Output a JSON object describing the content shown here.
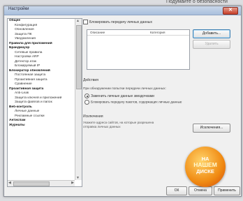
{
  "corner_caption": "Подумайте о безопасности",
  "window": {
    "title": "Настройки",
    "close_glyph": "✕"
  },
  "tree": {
    "items": [
      {
        "label": "Общее",
        "level": 0
      },
      {
        "label": "Конфигурация",
        "level": 1
      },
      {
        "label": "Обновления",
        "level": 1
      },
      {
        "label": "Защита ПК",
        "level": 1
      },
      {
        "label": "Уведомления",
        "level": 1
      },
      {
        "label": "Правила для приложений",
        "level": 0
      },
      {
        "label": "Брандмауэр",
        "level": 0
      },
      {
        "label": "Сетевые правила",
        "level": 1
      },
      {
        "label": "Настройки ARP",
        "level": 1
      },
      {
        "label": "Детектор атак",
        "level": 1
      },
      {
        "label": "Блокируемый IP",
        "level": 1
      },
      {
        "label": "Блокиратор обновлений",
        "level": 0
      },
      {
        "label": "Постоянная защита",
        "level": 1
      },
      {
        "label": "Проактивная защита",
        "level": 1
      },
      {
        "label": "Сравнение",
        "level": 1
      },
      {
        "label": "Проактивная защита",
        "level": 0
      },
      {
        "label": "Anti-Leak",
        "level": 1
      },
      {
        "label": "Защита ключей и приложений",
        "level": 1
      },
      {
        "label": "Защита файлов и папок",
        "level": 1
      },
      {
        "label": "Веб-контроль",
        "level": 0
      },
      {
        "label": "Личные данные",
        "level": 1
      },
      {
        "label": "Рекламные ссылки",
        "level": 1
      },
      {
        "label": "Антиспам",
        "level": 0
      },
      {
        "label": "Журналы",
        "level": 0
      }
    ]
  },
  "private_data": {
    "enable_checkbox_label": "Блокировать передачу личных данных",
    "enable_checked": false,
    "columns": [
      "Описание",
      "Категория"
    ],
    "add_button": "Добавить...",
    "remove_button": "Удалить"
  },
  "actions": {
    "label": "Действия",
    "question": "При обнаружении попытки передачи личных данных:",
    "option_replace": "Заменить личные данные звездочками",
    "option_replace_selected": true,
    "option_block": "Блокировать передачу пакетов, содержащих личные данные",
    "option_block_selected": false
  },
  "exclusions": {
    "label": "Исключения",
    "description": "Укажите адреса сайтов, на которые разрешена отправка личных данных",
    "button": "Исключения..."
  },
  "badge": {
    "line1": "НА",
    "line2": "НАШЕМ",
    "line3": "ДИСКЕ"
  },
  "footer": {
    "ok": "ОК",
    "cancel": "Отмена",
    "apply": "Применить"
  },
  "colors": {
    "badge": "#f08a12",
    "titlebar": "#b8cce6"
  }
}
